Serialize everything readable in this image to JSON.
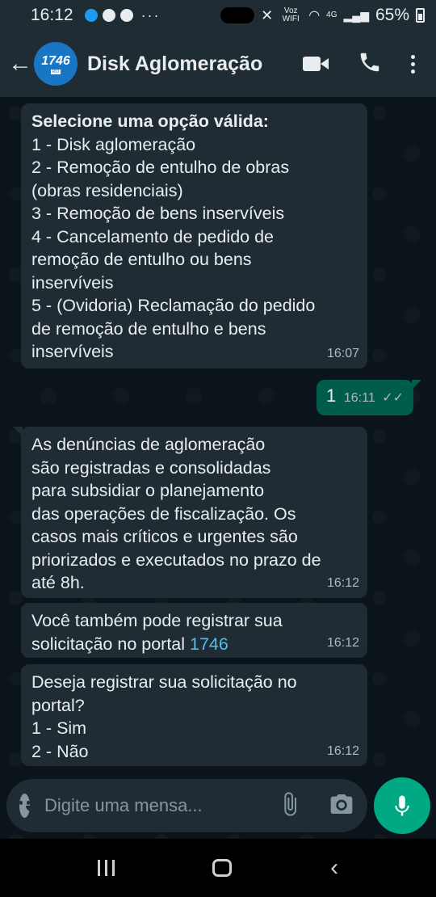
{
  "status_bar": {
    "time": "16:12",
    "more": "···",
    "voz_wifi": "Voz WIFI",
    "network": "4G",
    "battery": "65%"
  },
  "header": {
    "contact_name": "Disk Aglomeração",
    "avatar_text": "1746",
    "avatar_subtext": "RIO"
  },
  "messages": [
    {
      "direction": "in",
      "title": "Selecione uma opção válida:",
      "lines": [
        "1 - Disk aglomeração",
        "2 - Remoção de entulho de obras",
        "(obras residenciais)",
        "3 - Remoção de bens inservíveis",
        "4 - Cancelamento de pedido de",
        "remoção de entulho ou bens",
        "inservíveis",
        "5 - (Ovidoria) Reclamação do pedido",
        "de remoção de entulho e bens",
        "inservíveis"
      ],
      "time": "16:07"
    },
    {
      "direction": "out",
      "text": "1",
      "time": "16:11"
    },
    {
      "direction": "in",
      "lines": [
        "As denúncias de aglomeração",
        "são registradas e consolidadas",
        "para subsidiar o planejamento",
        "das operações de fiscalização. Os",
        "casos mais críticos e urgentes são",
        "priorizados e executados no prazo de",
        "até 8h."
      ],
      "time": "16:12"
    },
    {
      "direction": "in",
      "lines": [
        "Você também pode registrar sua",
        "solicitação no portal "
      ],
      "link": "1746",
      "time": "16:12"
    },
    {
      "direction": "in",
      "lines": [
        "Deseja registrar sua solicitação no",
        "portal?",
        "1 - Sim",
        "2 - Não"
      ],
      "time": "16:12"
    }
  ],
  "input": {
    "placeholder": "Digite uma mensa..."
  },
  "colors": {
    "background": "#0b141a",
    "header": "#1f2c34",
    "incoming_bubble": "#1f2c34",
    "outgoing_bubble": "#005c4b",
    "accent": "#00a884",
    "link": "#53bdeb"
  }
}
